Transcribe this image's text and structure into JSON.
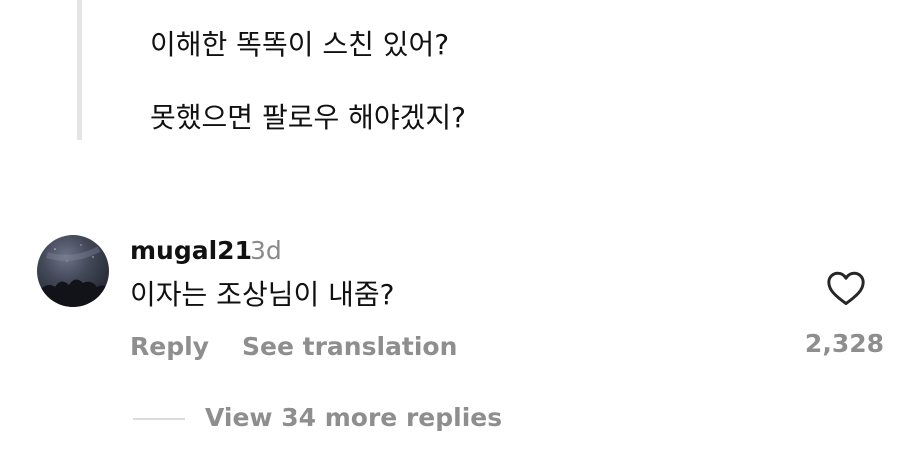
{
  "quoted_post": {
    "lines": [
      "이해한 똑똑이 스친 있어?",
      "못했으면 팔로우 해야겠지?"
    ]
  },
  "comment": {
    "avatar_icon": "avatar-image",
    "username": "mugal21",
    "timestamp": "3d",
    "text": "이자는 조상님이 내줌?",
    "actions": {
      "reply": "Reply",
      "translate": "See translation"
    },
    "like_icon": "heart-outline-icon",
    "like_count": "2,328"
  },
  "replies": {
    "view_more": "View 34 more replies"
  },
  "colors": {
    "text_primary": "#111111",
    "text_secondary": "#8e8e8e",
    "quote_bar": "#e4e4e4"
  }
}
